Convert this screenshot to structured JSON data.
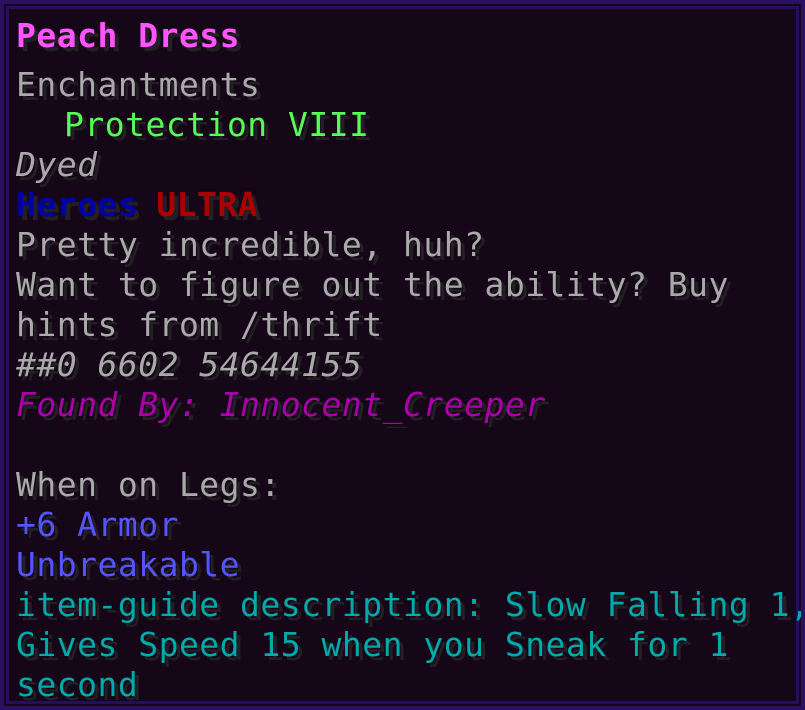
{
  "colors": {
    "title": "#ff55ff",
    "gray": "#aaaaaa",
    "green": "#55ff55",
    "dark_blue": "#0000aa",
    "dark_red": "#aa0000",
    "purple": "#aa00aa",
    "blue": "#5555ff",
    "aqua": "#00aaaa"
  },
  "item": {
    "name": "Peach Dress",
    "enchantments_header": "Enchantments",
    "enchantment": "Protection VIII",
    "dyed": "Dyed",
    "tier_prefix": "Heroes",
    "tier": "ULTRA",
    "lore": [
      "Pretty incredible, huh?",
      "Want to figure out the ability? Buy",
      "hints from /thrift"
    ],
    "id_code": "##0 6602 54644155",
    "found_by": "Found By: Innocent_Creeper",
    "slot_header": "When on Legs:",
    "armor": "+6 Armor",
    "unbreakable": "Unbreakable",
    "guide": [
      "item-guide description: Slow Falling 1,",
      "Gives Speed 15 when you Sneak for 1",
      "second"
    ]
  }
}
